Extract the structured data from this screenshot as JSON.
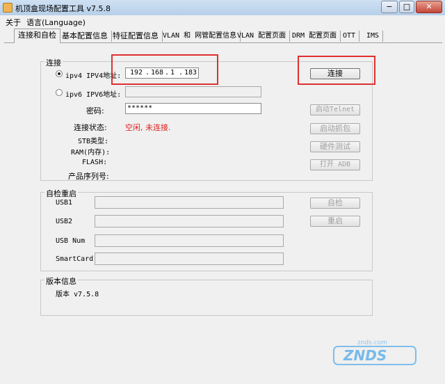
{
  "window": {
    "title": "机顶盒现场配置工具 v7.5.8",
    "buttons": {
      "minimize": "−",
      "maximize": "□",
      "close": "✕"
    }
  },
  "menu": {
    "items": [
      "关于",
      "语言(Language)"
    ]
  },
  "tabs": [
    "连接和自检",
    "基本配置信息",
    "特征配置信息",
    "VLAN 和 网管配置信息",
    "VLAN 配置页面",
    "DRM 配置页面",
    "OTT",
    "IMS"
  ],
  "connect_group": {
    "legend": "连接",
    "ipv4_label": "ipv4 IPV4地址:",
    "ipv4_selected": true,
    "ip_octets": [
      "192",
      "168",
      "1",
      "183"
    ],
    "ipv6_label": "ipv6 IPV6地址:",
    "ipv6_value": "",
    "password_label": "密码:",
    "password_value": "******",
    "status_label": "连接状态:",
    "status_value": "空闲, 未连接.",
    "stb_type_label": "STB类型:",
    "ram_label": "RAM(内存):",
    "flash_label": "FLASH:",
    "serial_label": "产品序列号:",
    "connect_button": "连接",
    "telnet_button": "启动Telnet",
    "capture_button": "启动抓包",
    "hwtest_button": "硬件测试",
    "adb_button": "打开 ADB"
  },
  "selftest_group": {
    "legend": "自检重启",
    "usb1_label": "USB1",
    "usb2_label": "USB2",
    "usbnum_label": "USB Num",
    "smartcard_label": "SmartCard",
    "selfcheck_button": "自检",
    "reboot_button": "重启"
  },
  "version_group": {
    "legend": "版本信息",
    "version_text": "版本 v7.5.8"
  },
  "colors": {
    "highlight": "#e03030",
    "status_text": "#e02020",
    "watermark": "#4fa8e8"
  }
}
